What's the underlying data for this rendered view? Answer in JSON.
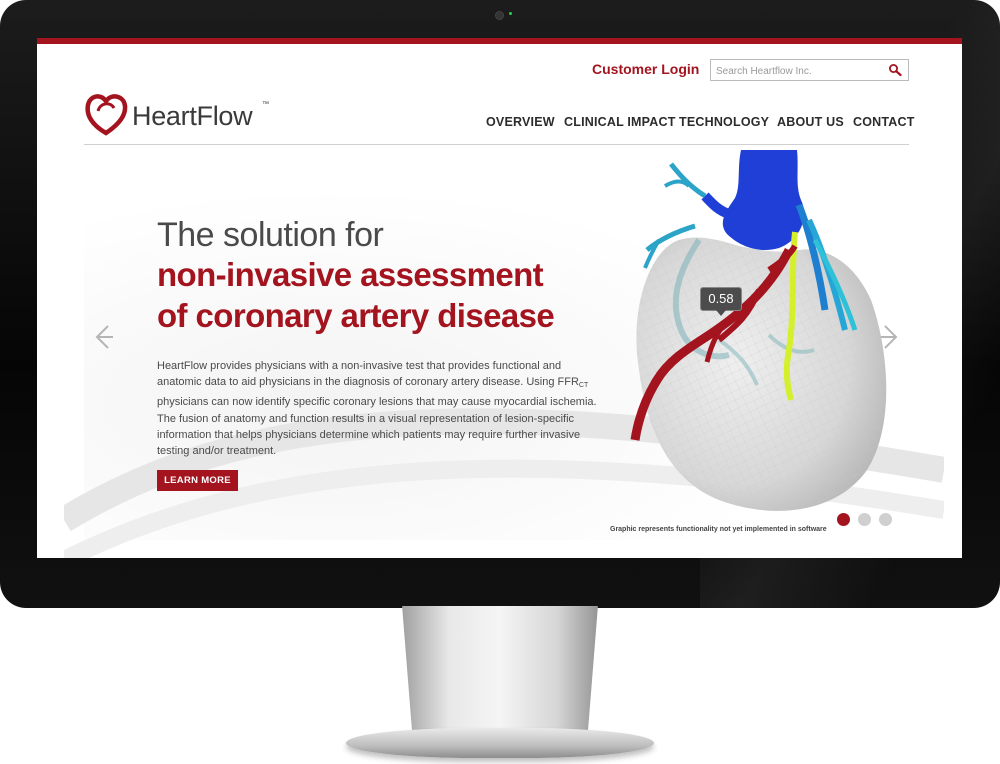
{
  "header": {
    "customer_login": "Customer Login",
    "search_placeholder": "Search Heartflow Inc."
  },
  "brand": {
    "name": "HeartFlow",
    "trademark": "™",
    "color": "#a3141f"
  },
  "nav": {
    "items": [
      {
        "label": "OVERVIEW"
      },
      {
        "label": "CLINICAL IMPACT"
      },
      {
        "label": "TECHNOLOGY"
      },
      {
        "label": "ABOUT US"
      },
      {
        "label": "CONTACT"
      }
    ]
  },
  "hero": {
    "headline_line1": "The solution for",
    "headline_line2": "non-invasive assessment",
    "headline_line3": "of coronary artery disease",
    "body_part1": "HeartFlow provides physicians with a non-invasive test that provides functional and anatomic data to aid physicians in the diagnosis of coronary artery disease. Using ",
    "ffr_main": "FFR",
    "ffr_sub": "CT",
    "body_part2": " physicians can now identify specific coronary lesions that may cause myocardial ischemia. The fusion of anatomy and function results in a visual representation of lesion-specific information that helps physicians determine which patients may require further invasive testing and/or treatment.",
    "cta_label": "LEARN MORE",
    "ffr_value": "0.58",
    "disclaimer": "Graphic represents functionality not yet implemented in software",
    "slides": [
      {
        "active": true
      },
      {
        "active": false
      },
      {
        "active": false
      }
    ]
  },
  "icons": {
    "prev": "chevron-left-icon",
    "next": "chevron-right-icon",
    "search": "search-icon"
  }
}
